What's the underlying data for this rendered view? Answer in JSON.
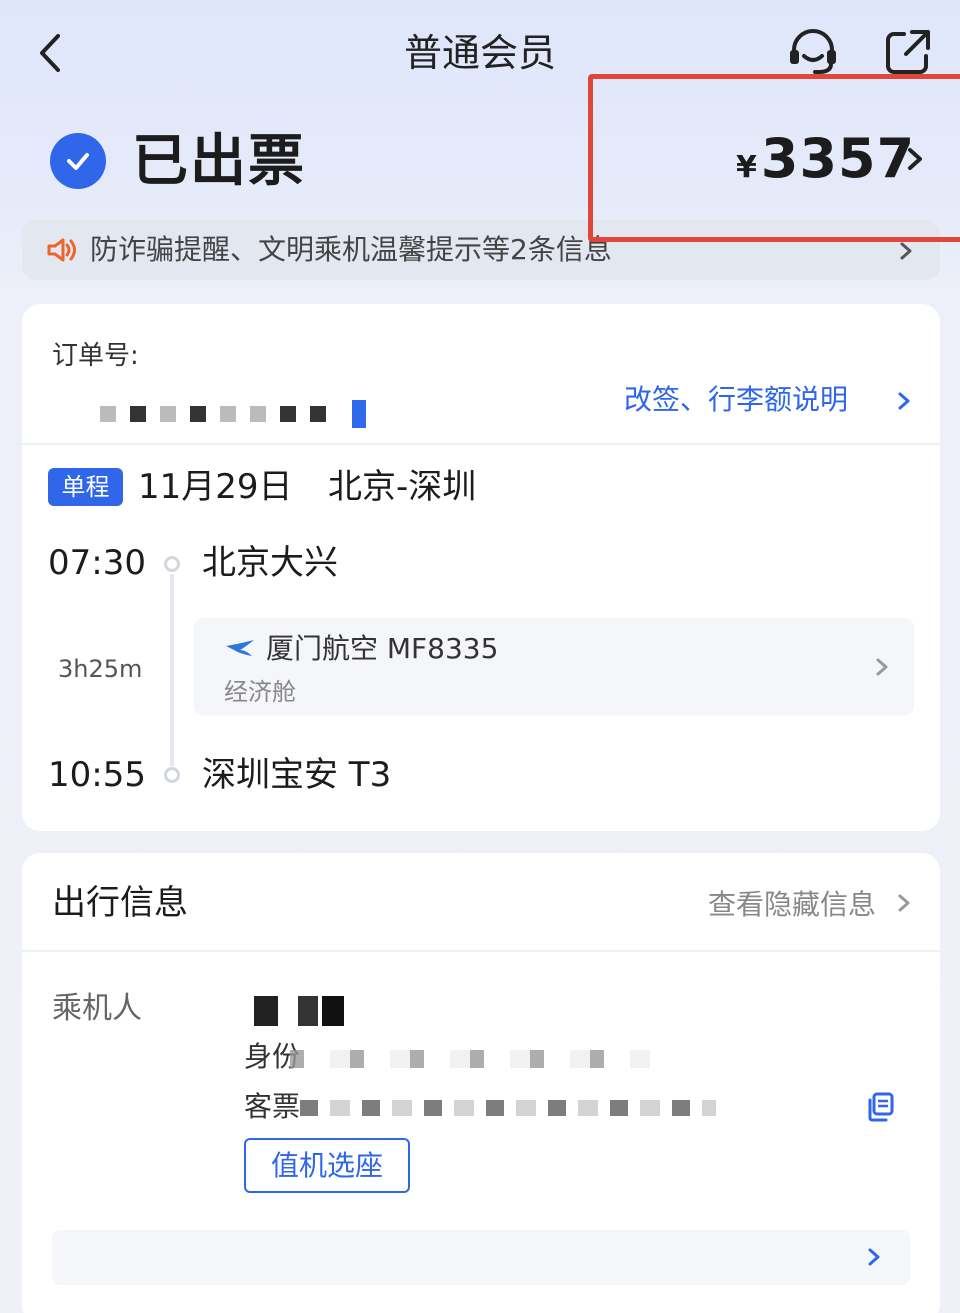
{
  "header": {
    "title": "普通会员"
  },
  "status": {
    "text": "已出票",
    "currency": "¥",
    "price": "3357"
  },
  "notice": {
    "text": "防诈骗提醒、文明乘机温馨提示等2条信息"
  },
  "order": {
    "label": "订单号:",
    "rules_link": "改签、行李额说明"
  },
  "trip": {
    "badge": "单程",
    "date": "11月29日",
    "route": "北京-深圳",
    "departure_time": "07:30",
    "departure_airport": "北京大兴",
    "duration": "3h25m",
    "flight": "厦门航空 MF8335",
    "cabin": "经济舱",
    "arrival_time": "10:55",
    "arrival_airport": "深圳宝安 T3"
  },
  "travel_info": {
    "title": "出行信息",
    "hidden_link": "查看隐藏信息",
    "passenger_label": "乘机人",
    "id_label": "身份",
    "ticket_label": "客票",
    "checkin_button": "值机选座"
  },
  "colors": {
    "accent": "#2f66ea",
    "highlight": "#e0463a",
    "speaker": "#e8662e"
  },
  "icons": [
    "back-icon",
    "customer-service-icon",
    "share-icon",
    "check-icon",
    "speaker-icon",
    "airline-logo-icon",
    "copy-icon"
  ]
}
